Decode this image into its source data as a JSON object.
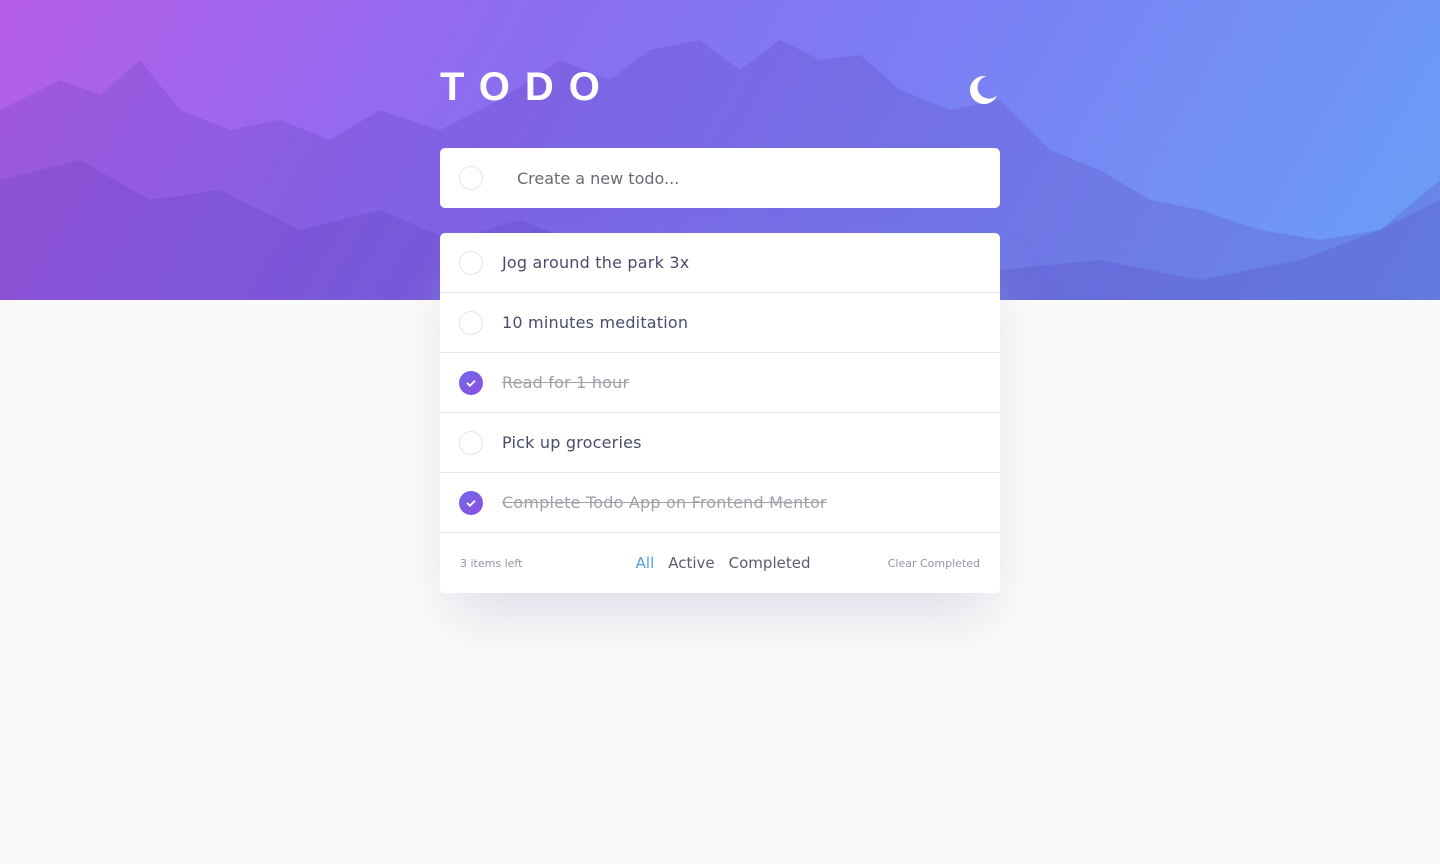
{
  "header": {
    "title": "TODO",
    "theme_icon": "moon-icon"
  },
  "new_todo": {
    "placeholder": "Create a new todo...",
    "value": ""
  },
  "todos": [
    {
      "text": "Jog around the park 3x",
      "completed": false
    },
    {
      "text": "10 minutes meditation",
      "completed": false
    },
    {
      "text": "Read for 1 hour",
      "completed": true
    },
    {
      "text": "Pick up groceries",
      "completed": false
    },
    {
      "text": "Complete Todo App on Frontend Mentor",
      "completed": true
    }
  ],
  "footer": {
    "items_left": "3 items left",
    "filters": [
      "All",
      "Active",
      "Completed"
    ],
    "active_filter": "All",
    "clear_label": "Clear Completed"
  },
  "colors": {
    "accent": "#4fa3e2",
    "check_gradient_start": "#6e6ae9",
    "check_gradient_end": "#8d4fe0",
    "text": "#494c6b",
    "completed_text": "#a0a0a8"
  }
}
